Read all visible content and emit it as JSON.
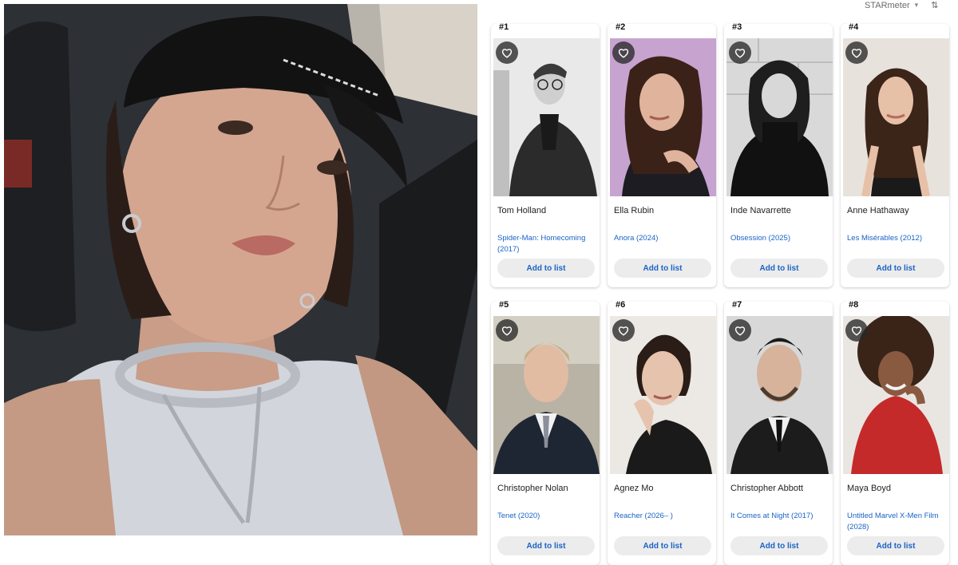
{
  "sort_control": {
    "label": "STARmeter"
  },
  "cards": [
    {
      "rank": "#1",
      "name": "Tom Holland",
      "title": "Spider-Man: Homecoming (2017)",
      "button": "Add to list"
    },
    {
      "rank": "#2",
      "name": "Ella Rubin",
      "title": "Anora (2024)",
      "button": "Add to list"
    },
    {
      "rank": "#3",
      "name": "Inde Navarrette",
      "title": "Obsession (2025)",
      "button": "Add to list"
    },
    {
      "rank": "#4",
      "name": "Anne Hathaway",
      "title": "Les Misérables (2012)",
      "button": "Add to list"
    },
    {
      "rank": "#5",
      "name": "Christopher Nolan",
      "title": "Tenet (2020)",
      "button": "Add to list"
    },
    {
      "rank": "#6",
      "name": "Agnez Mo",
      "title": "Reacher (2026– )",
      "button": "Add to list"
    },
    {
      "rank": "#7",
      "name": "Christopher Abbott",
      "title": "It Comes at Night (2017)",
      "button": "Add to list"
    },
    {
      "rank": "#8",
      "name": "Maya Boyd",
      "title": "Untitled Marvel X-Men Film (2028)",
      "button": "Add to list"
    }
  ],
  "colors": {
    "link": "#1a63c6",
    "button_bg": "#ececec",
    "heart_bg": "#3a3a3a"
  },
  "icons": {
    "favorite": "heart-outline-icon",
    "sort": "sort-arrows-icon",
    "dropdown": "caret-down-icon"
  }
}
